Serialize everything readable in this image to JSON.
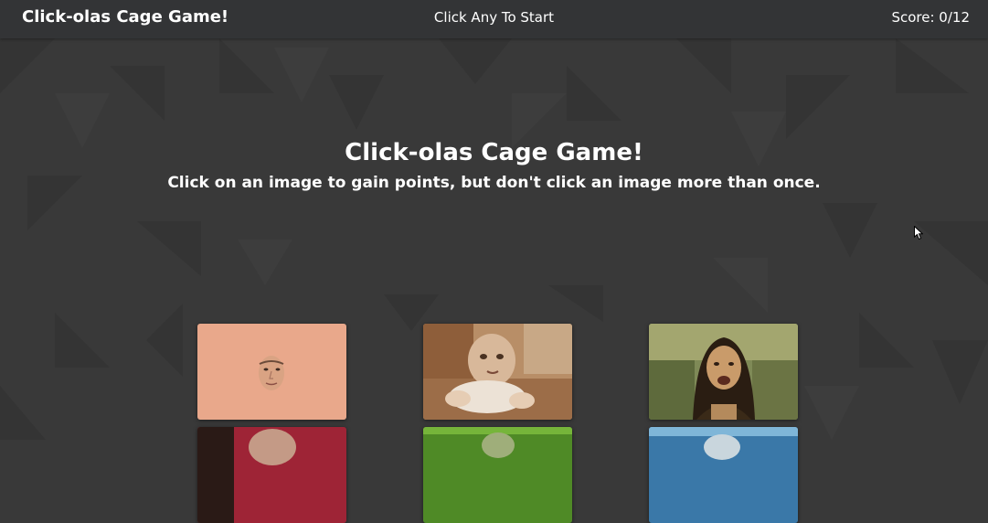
{
  "navbar": {
    "brand": "Click-olas Cage Game!",
    "status": "Click Any To Start",
    "score": "Score: 0/12"
  },
  "hero": {
    "title": "Click-olas Cage Game!",
    "subtitle": "Click on an image to gain points, but don't click an image more than once."
  },
  "colors": {
    "background": "#393939",
    "navbar": "#333436",
    "text": "#ffffff"
  },
  "cards": [
    {
      "icon": "cage-face-peach-icon"
    },
    {
      "icon": "cage-baby-icon"
    },
    {
      "icon": "cage-mona-lisa-icon"
    },
    {
      "icon": "cage-red-icon"
    },
    {
      "icon": "cage-green-icon"
    },
    {
      "icon": "cage-blue-icon"
    }
  ]
}
